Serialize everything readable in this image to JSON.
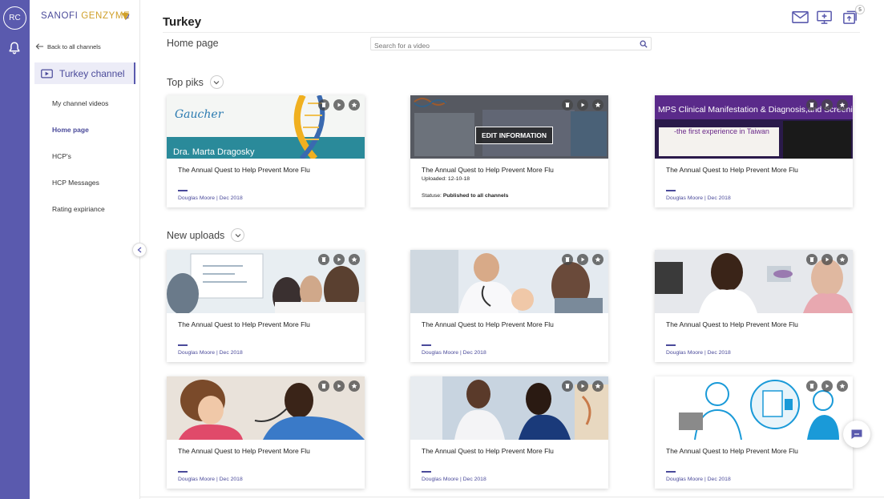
{
  "rail": {
    "avatar": "RC"
  },
  "sidebar": {
    "logo_primary": "SANOFI",
    "logo_secondary": "GENZYME",
    "back_label": "Back to all channels",
    "channel_label": "Turkey channel",
    "items": [
      {
        "label": "My channel videos",
        "active": false
      },
      {
        "label": "Home page",
        "active": true
      },
      {
        "label": "HCP's",
        "active": false
      },
      {
        "label": "HCP Messages",
        "active": false
      },
      {
        "label": "Rating expiriance",
        "active": false
      }
    ]
  },
  "header": {
    "title": "Turkey",
    "page_label": "Home page",
    "search_placeholder": "Search for a video",
    "notification_count": "5"
  },
  "sections": {
    "top": {
      "title": "Top piks"
    },
    "new": {
      "title": "New uploads"
    }
  },
  "cards": {
    "c1": {
      "title": "The Annual Quest to Help Prevent More Flu",
      "author": "Douglas Moore | Dec 2018",
      "thumb_text": "Dra. Marta Dragosky",
      "thumb_brand": "Gaucher"
    },
    "c2": {
      "title": "The Annual Quest to Help Prevent More Flu",
      "uploaded": "Uploaded: 12-10-18",
      "status_label": "Statuse:",
      "status_value": "Published to all channels",
      "edit_label": "EDIT INFORMATION"
    },
    "c3": {
      "title": "The Annual Quest to Help Prevent More Flu",
      "author": "Douglas Moore | Dec 2018",
      "thumb_text": "MPS Clinical Manifestation & Diagnosis,and Screening",
      "thumb_sub": "-the first experience in Taiwan"
    },
    "c4": {
      "title": "The Annual Quest to Help Prevent More Flu",
      "author": "Douglas Moore | Dec 2018"
    },
    "c5": {
      "title": "The Annual Quest to Help Prevent More Flu",
      "author": "Douglas Moore | Dec 2018"
    },
    "c6": {
      "title": "The Annual Quest to Help Prevent More Flu",
      "author": "Douglas Moore | Dec 2018"
    },
    "c7": {
      "title": "The Annual Quest to Help Prevent More Flu",
      "author": "Douglas Moore | Dec 2018"
    },
    "c8": {
      "title": "The Annual Quest to Help Prevent More Flu",
      "author": "Douglas Moore | Dec 2018"
    },
    "c9": {
      "title": "The Annual Quest to Help Prevent More Flu",
      "author": "Douglas Moore | Dec 2018"
    }
  },
  "colors": {
    "accent": "#5a5aae",
    "brand_gold": "#d0a02a"
  }
}
